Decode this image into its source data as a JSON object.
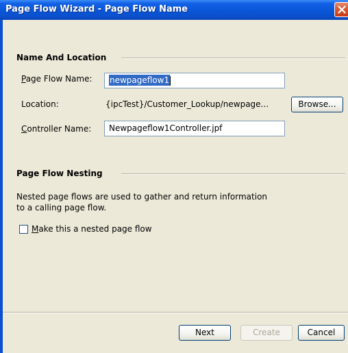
{
  "window": {
    "title": "Page Flow Wizard - Page Flow Name"
  },
  "name_location": {
    "heading": "Name And Location",
    "page_flow_name_label": "Page Flow Name:",
    "page_flow_name_value": "newpageflow1",
    "location_label": "Location:",
    "location_value": "{ipcTest}/Customer_Lookup/newpage...",
    "browse_button": "Browse...",
    "controller_name_label": "Controller Name:",
    "controller_name_value": "Newpageflow1Controller.jpf"
  },
  "nesting": {
    "heading": "Page Flow Nesting",
    "description_line1": "Nested page flows are used to gather and return information",
    "description_line2": "to a calling page flow.",
    "checkbox_label": "Make this a nested page flow",
    "checkbox_checked": false
  },
  "buttons": {
    "next": "Next",
    "create": "Create",
    "cancel": "Cancel"
  }
}
